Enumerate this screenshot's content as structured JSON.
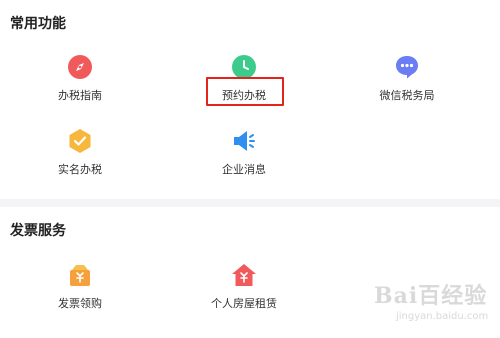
{
  "sections": [
    {
      "title": "常用功能",
      "items": [
        {
          "label": "办税指南",
          "icon": "compass-icon",
          "color": "#f05a5a"
        },
        {
          "label": "预约办税",
          "icon": "clock-icon",
          "color": "#3ccb8a"
        },
        {
          "label": "微信税务局",
          "icon": "chat-bubble-icon",
          "color": "#6a7df2"
        },
        {
          "label": "实名办税",
          "icon": "verified-shield-icon",
          "color": "#f6b73c"
        },
        {
          "label": "企业消息",
          "icon": "megaphone-icon",
          "color": "#2f8ff0"
        }
      ]
    },
    {
      "title": "发票服务",
      "items": [
        {
          "label": "发票领购",
          "icon": "invoice-bag-icon",
          "color": "#f6a03c"
        },
        {
          "label": "个人房屋租赁",
          "icon": "house-yen-icon",
          "color": "#f05a5a"
        }
      ]
    }
  ],
  "highlight_color": "#e3241b",
  "watermark": {
    "line1": "Bai百经验",
    "line2": "jingyan.baidu.com"
  }
}
